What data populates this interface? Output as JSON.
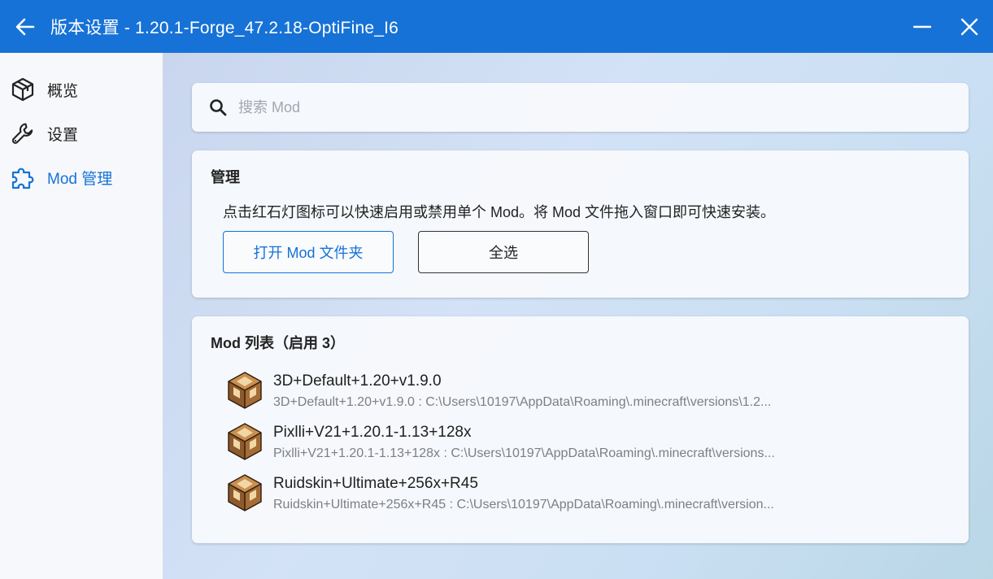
{
  "header": {
    "title": "版本设置 - 1.20.1-Forge_47.2.18-OptiFine_I6"
  },
  "sidebar": {
    "items": [
      {
        "label": "概览",
        "icon": "cube-icon"
      },
      {
        "label": "设置",
        "icon": "wrench-icon"
      },
      {
        "label": "Mod 管理",
        "icon": "puzzle-icon",
        "active": true
      }
    ]
  },
  "search": {
    "placeholder": "搜索 Mod",
    "value": ""
  },
  "manage": {
    "title": "管理",
    "description": "点击红石灯图标可以快速启用或禁用单个 Mod。将 Mod 文件拖入窗口即可快速安装。",
    "open_folder_label": "打开 Mod 文件夹",
    "select_all_label": "全选"
  },
  "mod_list": {
    "title": "Mod 列表（启用 3）",
    "items": [
      {
        "name": "3D+Default+1.20+v1.9.0",
        "path": "3D+Default+1.20+v1.9.0 : C:\\Users\\10197\\AppData\\Roaming\\.minecraft\\versions\\1.2...",
        "icon": "redstone-lamp-icon"
      },
      {
        "name": "Pixlli+V21+1.20.1-1.13+128x",
        "path": "Pixlli+V21+1.20.1-1.13+128x : C:\\Users\\10197\\AppData\\Roaming\\.minecraft\\versions...",
        "icon": "redstone-lamp-icon"
      },
      {
        "name": "Ruidskin+Ultimate+256x+R45",
        "path": "Ruidskin+Ultimate+256x+R45 : C:\\Users\\10197\\AppData\\Roaming\\.minecraft\\version...",
        "icon": "redstone-lamp-icon"
      }
    ]
  },
  "colors": {
    "accent": "#1672d6",
    "sidebar_bg": "#f6f8fb",
    "card_bg": "#f7f9fc"
  }
}
